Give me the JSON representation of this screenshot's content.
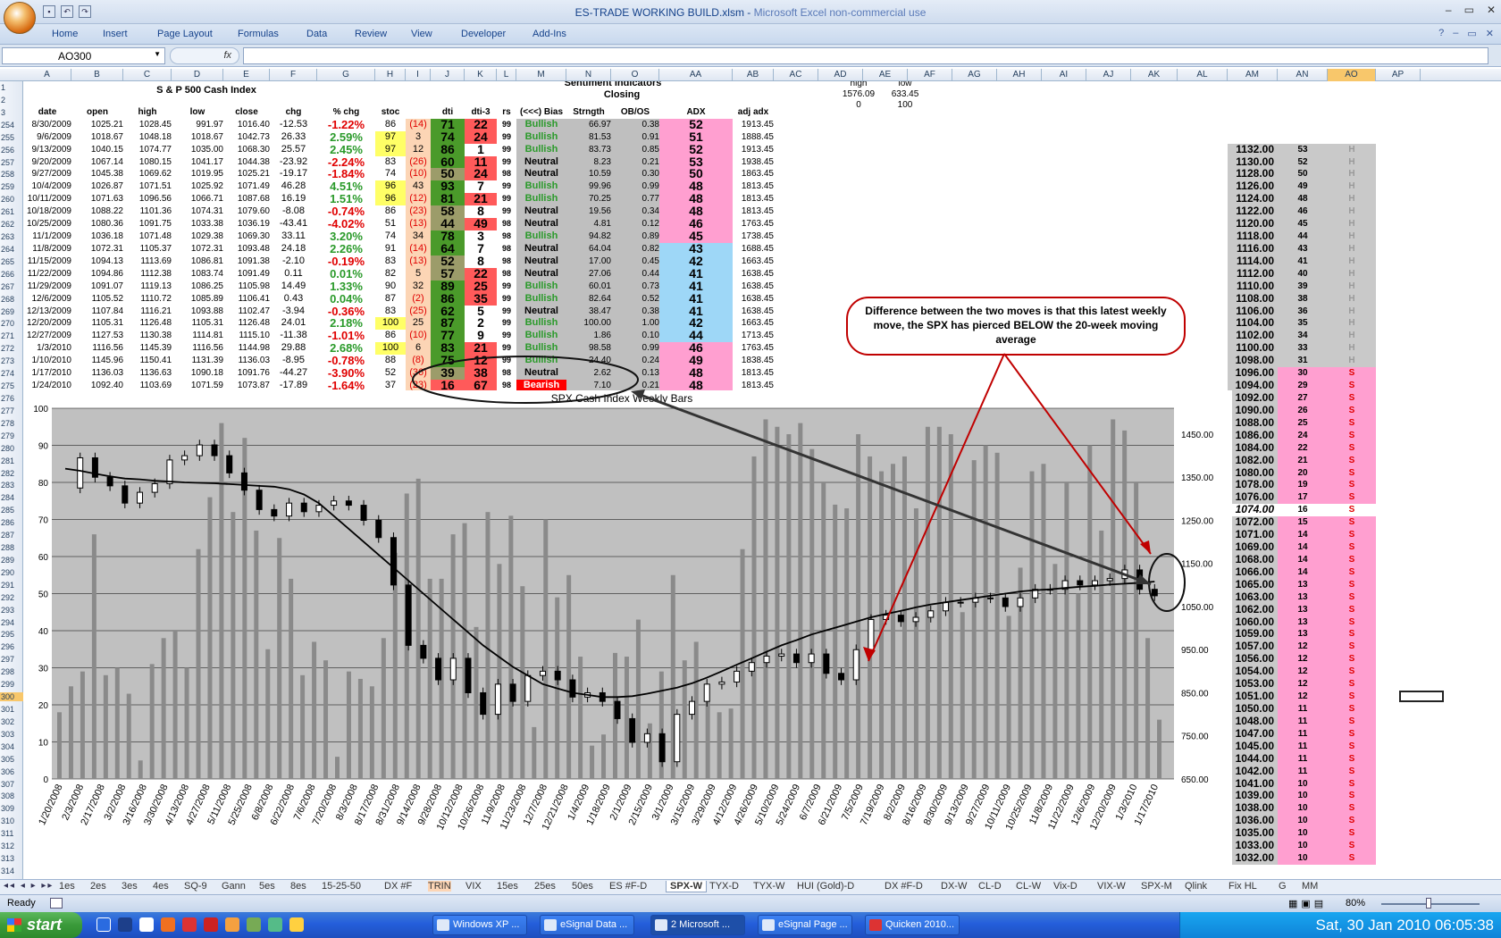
{
  "window": {
    "title": "ES-TRADE WORKING BUILD.xlsm",
    "subtitle": "Microsoft Excel non-commercial use",
    "minimize": "–",
    "restore": "▭",
    "close": "✕"
  },
  "ribbon": {
    "tabs": [
      "Home",
      "Insert",
      "Page Layout",
      "Formulas",
      "Data",
      "Review",
      "View",
      "Developer",
      "Add-Ins"
    ]
  },
  "formula_bar": {
    "name_box": "AO300",
    "fx": "fx",
    "value": ""
  },
  "columns": [
    "A",
    "B",
    "C",
    "D",
    "E",
    "F",
    "G",
    "H",
    "I",
    "J",
    "K",
    "L",
    "M",
    "N",
    "O",
    "AA",
    "AB",
    "AC",
    "AD",
    "AE",
    "AF",
    "AG",
    "AH",
    "AI",
    "AJ",
    "AK",
    "AL",
    "AM",
    "AN",
    "AO",
    "AP"
  ],
  "selected_column": "AO",
  "rows_visible": [
    "1",
    "2",
    "3",
    "254",
    "255",
    "256",
    "257",
    "258",
    "259",
    "260",
    "261",
    "262",
    "263",
    "264",
    "265",
    "266",
    "267",
    "268",
    "269",
    "270",
    "271",
    "272",
    "273",
    "274",
    "275",
    "276",
    "277",
    "278",
    "279",
    "280",
    "281",
    "282",
    "283",
    "284",
    "285",
    "286",
    "287",
    "288",
    "289",
    "290",
    "291",
    "292",
    "293",
    "294",
    "295",
    "296",
    "297",
    "298",
    "299",
    "300",
    "301",
    "302",
    "303",
    "304",
    "305",
    "306",
    "307",
    "308",
    "309",
    "310",
    "311",
    "312",
    "313",
    "314"
  ],
  "headers": {
    "sp500": "S & P 500 Cash Index",
    "sentiment": "Sentiment Indicators",
    "closing": "Closing",
    "cols": [
      "date",
      "open",
      "high",
      "low",
      "close",
      "chg",
      "% chg",
      "stoc",
      "",
      "dti",
      "dti-3",
      "rs",
      "(<<<) Bias",
      "Strngth",
      "OB/OS",
      "ADX",
      "adj adx"
    ],
    "hl": {
      "high_label": "high",
      "low_label": "low",
      "high_val": "1576.09",
      "low_val": "633.45",
      "high_sub": "0",
      "low_sub": "100"
    }
  },
  "data_rows": [
    [
      "8/30/2009",
      "1025.21",
      "1028.45",
      "991.97",
      "1016.40",
      "-12.53",
      "-1.22%",
      "86",
      "(14)",
      "71",
      "22",
      "99",
      "Bullish",
      "66.97",
      "0.38",
      "52",
      "1913.45"
    ],
    [
      "9/6/2009",
      "1018.67",
      "1048.18",
      "1018.67",
      "1042.73",
      "26.33",
      "2.59%",
      "97",
      "3",
      "74",
      "24",
      "99",
      "Bullish",
      "81.53",
      "0.91",
      "51",
      "1888.45"
    ],
    [
      "9/13/2009",
      "1040.15",
      "1074.77",
      "1035.00",
      "1068.30",
      "25.57",
      "2.45%",
      "97",
      "12",
      "86",
      "1",
      "99",
      "Bullish",
      "83.73",
      "0.85",
      "52",
      "1913.45"
    ],
    [
      "9/20/2009",
      "1067.14",
      "1080.15",
      "1041.17",
      "1044.38",
      "-23.92",
      "-2.24%",
      "83",
      "(26)",
      "60",
      "11",
      "99",
      "Neutral",
      "8.23",
      "0.21",
      "53",
      "1938.45"
    ],
    [
      "9/27/2009",
      "1045.38",
      "1069.62",
      "1019.95",
      "1025.21",
      "-19.17",
      "-1.84%",
      "74",
      "(10)",
      "50",
      "24",
      "98",
      "Neutral",
      "10.59",
      "0.30",
      "50",
      "1863.45"
    ],
    [
      "10/4/2009",
      "1026.87",
      "1071.51",
      "1025.92",
      "1071.49",
      "46.28",
      "4.51%",
      "96",
      "43",
      "93",
      "7",
      "99",
      "Bullish",
      "99.96",
      "0.99",
      "48",
      "1813.45"
    ],
    [
      "10/11/2009",
      "1071.63",
      "1096.56",
      "1066.71",
      "1087.68",
      "16.19",
      "1.51%",
      "96",
      "(12)",
      "81",
      "21",
      "99",
      "Bullish",
      "70.25",
      "0.77",
      "48",
      "1813.45"
    ],
    [
      "10/18/2009",
      "1088.22",
      "1101.36",
      "1074.31",
      "1079.60",
      "-8.08",
      "-0.74%",
      "86",
      "(23)",
      "58",
      "8",
      "99",
      "Neutral",
      "19.56",
      "0.34",
      "48",
      "1813.45"
    ],
    [
      "10/25/2009",
      "1080.36",
      "1091.75",
      "1033.38",
      "1036.19",
      "-43.41",
      "-4.02%",
      "51",
      "(13)",
      "44",
      "49",
      "98",
      "Neutral",
      "4.81",
      "0.12",
      "46",
      "1763.45"
    ],
    [
      "11/1/2009",
      "1036.18",
      "1071.48",
      "1029.38",
      "1069.30",
      "33.11",
      "3.20%",
      "74",
      "34",
      "78",
      "3",
      "98",
      "Bullish",
      "94.82",
      "0.89",
      "45",
      "1738.45"
    ],
    [
      "11/8/2009",
      "1072.31",
      "1105.37",
      "1072.31",
      "1093.48",
      "24.18",
      "2.26%",
      "91",
      "(14)",
      "64",
      "7",
      "98",
      "Neutral",
      "64.04",
      "0.82",
      "43",
      "1688.45"
    ],
    [
      "11/15/2009",
      "1094.13",
      "1113.69",
      "1086.81",
      "1091.38",
      "-2.10",
      "-0.19%",
      "83",
      "(13)",
      "52",
      "8",
      "98",
      "Neutral",
      "17.00",
      "0.45",
      "42",
      "1663.45"
    ],
    [
      "11/22/2009",
      "1094.86",
      "1112.38",
      "1083.74",
      "1091.49",
      "0.11",
      "0.01%",
      "82",
      "5",
      "57",
      "22",
      "98",
      "Neutral",
      "27.06",
      "0.44",
      "41",
      "1638.45"
    ],
    [
      "11/29/2009",
      "1091.07",
      "1119.13",
      "1086.25",
      "1105.98",
      "14.49",
      "1.33%",
      "90",
      "32",
      "89",
      "25",
      "99",
      "Bullish",
      "60.01",
      "0.73",
      "41",
      "1638.45"
    ],
    [
      "12/6/2009",
      "1105.52",
      "1110.72",
      "1085.89",
      "1106.41",
      "0.43",
      "0.04%",
      "87",
      "(2)",
      "86",
      "35",
      "99",
      "Bullish",
      "82.64",
      "0.52",
      "41",
      "1638.45"
    ],
    [
      "12/13/2009",
      "1107.84",
      "1116.21",
      "1093.88",
      "1102.47",
      "-3.94",
      "-0.36%",
      "83",
      "(25)",
      "62",
      "5",
      "99",
      "Neutral",
      "38.47",
      "0.38",
      "41",
      "1638.45"
    ],
    [
      "12/20/2009",
      "1105.31",
      "1126.48",
      "1105.31",
      "1126.48",
      "24.01",
      "2.18%",
      "100",
      "25",
      "87",
      "2",
      "99",
      "Bullish",
      "100.00",
      "1.00",
      "42",
      "1663.45"
    ],
    [
      "12/27/2009",
      "1127.53",
      "1130.38",
      "1114.81",
      "1115.10",
      "-11.38",
      "-1.01%",
      "86",
      "(10)",
      "77",
      "9",
      "99",
      "Bullish",
      "1.86",
      "0.10",
      "44",
      "1713.45"
    ],
    [
      "1/3/2010",
      "1116.56",
      "1145.39",
      "1116.56",
      "1144.98",
      "29.88",
      "2.68%",
      "100",
      "6",
      "83",
      "21",
      "99",
      "Bullish",
      "98.58",
      "0.99",
      "46",
      "1763.45"
    ],
    [
      "1/10/2010",
      "1145.96",
      "1150.41",
      "1131.39",
      "1136.03",
      "-8.95",
      "-0.78%",
      "88",
      "(8)",
      "75",
      "12",
      "99",
      "Bullish",
      "24.40",
      "0.24",
      "49",
      "1838.45"
    ],
    [
      "1/17/2010",
      "1136.03",
      "1136.63",
      "1090.18",
      "1091.76",
      "-44.27",
      "-3.90%",
      "52",
      "(36)",
      "39",
      "38",
      "98",
      "Neutral",
      "2.62",
      "0.13",
      "48",
      "1813.45"
    ],
    [
      "1/24/2010",
      "1092.40",
      "1103.69",
      "1071.59",
      "1073.87",
      "-17.89",
      "-1.64%",
      "37",
      "(23)",
      "16",
      "67",
      "98",
      "Bearish",
      "7.10",
      "0.21",
      "48",
      "1813.45"
    ]
  ],
  "right_table": [
    [
      "1132.00",
      "53",
      "H"
    ],
    [
      "1130.00",
      "52",
      "H"
    ],
    [
      "1128.00",
      "50",
      "H"
    ],
    [
      "1126.00",
      "49",
      "H"
    ],
    [
      "1124.00",
      "48",
      "H"
    ],
    [
      "1122.00",
      "46",
      "H"
    ],
    [
      "1120.00",
      "45",
      "H"
    ],
    [
      "1118.00",
      "44",
      "H"
    ],
    [
      "1116.00",
      "43",
      "H"
    ],
    [
      "1114.00",
      "41",
      "H"
    ],
    [
      "1112.00",
      "40",
      "H"
    ],
    [
      "1110.00",
      "39",
      "H"
    ],
    [
      "1108.00",
      "38",
      "H"
    ],
    [
      "1106.00",
      "36",
      "H"
    ],
    [
      "1104.00",
      "35",
      "H"
    ],
    [
      "1102.00",
      "34",
      "H"
    ],
    [
      "1100.00",
      "33",
      "H"
    ],
    [
      "1098.00",
      "31",
      "H"
    ],
    [
      "1096.00",
      "30",
      "S"
    ],
    [
      "1094.00",
      "29",
      "S"
    ],
    [
      "1092.00",
      "27",
      "S"
    ],
    [
      "1090.00",
      "26",
      "S"
    ],
    [
      "1088.00",
      "25",
      "S"
    ],
    [
      "1086.00",
      "24",
      "S"
    ],
    [
      "1084.00",
      "22",
      "S"
    ],
    [
      "1082.00",
      "21",
      "S"
    ],
    [
      "1080.00",
      "20",
      "S"
    ],
    [
      "1078.00",
      "19",
      "S"
    ],
    [
      "1076.00",
      "17",
      "S"
    ],
    [
      "1074.00",
      "16",
      "S"
    ],
    [
      "1072.00",
      "15",
      "S"
    ],
    [
      "1071.00",
      "14",
      "S"
    ],
    [
      "1069.00",
      "14",
      "S"
    ],
    [
      "1068.00",
      "14",
      "S"
    ],
    [
      "1066.00",
      "14",
      "S"
    ],
    [
      "1065.00",
      "13",
      "S"
    ],
    [
      "1063.00",
      "13",
      "S"
    ],
    [
      "1062.00",
      "13",
      "S"
    ],
    [
      "1060.00",
      "13",
      "S"
    ],
    [
      "1059.00",
      "13",
      "S"
    ],
    [
      "1057.00",
      "12",
      "S"
    ],
    [
      "1056.00",
      "12",
      "S"
    ],
    [
      "1054.00",
      "12",
      "S"
    ],
    [
      "1053.00",
      "12",
      "S"
    ],
    [
      "1051.00",
      "12",
      "S"
    ],
    [
      "1050.00",
      "11",
      "S"
    ],
    [
      "1048.00",
      "11",
      "S"
    ],
    [
      "1047.00",
      "11",
      "S"
    ],
    [
      "1045.00",
      "11",
      "S"
    ],
    [
      "1044.00",
      "11",
      "S"
    ],
    [
      "1042.00",
      "11",
      "S"
    ],
    [
      "1041.00",
      "10",
      "S"
    ],
    [
      "1039.00",
      "10",
      "S"
    ],
    [
      "1038.00",
      "10",
      "S"
    ],
    [
      "1036.00",
      "10",
      "S"
    ],
    [
      "1035.00",
      "10",
      "S"
    ],
    [
      "1033.00",
      "10",
      "S"
    ],
    [
      "1032.00",
      "10",
      "S"
    ]
  ],
  "callout": "Difference between the two moves is that this latest weekly move, the SPX has pierced BELOW the 20-week moving average",
  "chart_data": {
    "type": "candlestick",
    "title": "SPX Cash Index Weekly Bars",
    "left_axis": {
      "ticks": [
        "100",
        "90",
        "80",
        "70",
        "60",
        "50",
        "40",
        "30",
        "20",
        "10",
        "0"
      ],
      "range": [
        0,
        100
      ]
    },
    "right_axis": {
      "ticks": [
        "1450.00",
        "1350.00",
        "1250.00",
        "1150.00",
        "1050.00",
        "950.00",
        "850.00",
        "750.00",
        "650.00"
      ],
      "range": [
        650,
        1510
      ]
    },
    "x_labels": [
      "1/20/2008",
      "2/3/2008",
      "2/17/2008",
      "3/2/2008",
      "3/16/2008",
      "3/30/2008",
      "4/13/2008",
      "4/27/2008",
      "5/11/2008",
      "5/25/2008",
      "6/8/2008",
      "6/22/2008",
      "7/6/2008",
      "7/20/2008",
      "8/3/2008",
      "8/17/2008",
      "8/31/2008",
      "9/14/2008",
      "9/28/2008",
      "10/12/2008",
      "10/26/2008",
      "11/9/2008",
      "11/23/2008",
      "12/7/2008",
      "12/21/2008",
      "1/4/2009",
      "1/18/2009",
      "2/1/2009",
      "2/15/2009",
      "3/1/2009",
      "3/15/2009",
      "3/29/2009",
      "4/12/2009",
      "4/26/2009",
      "5/10/2009",
      "5/24/2009",
      "6/7/2009",
      "6/21/2009",
      "7/5/2009",
      "7/19/2009",
      "8/2/2009",
      "8/16/2009",
      "8/30/2009",
      "9/13/2009",
      "9/27/2009",
      "10/11/2009",
      "10/25/2009",
      "11/8/2009",
      "11/22/2009",
      "12/6/2009",
      "12/20/2009",
      "1/3/2010",
      "1/17/2010"
    ],
    "closes": [
      1325,
      1395,
      1350,
      1330,
      1290,
      1315,
      1335,
      1390,
      1400,
      1425,
      1400,
      1360,
      1320,
      1275,
      1260,
      1290,
      1270,
      1285,
      1295,
      1285,
      1250,
      1210,
      1100,
      960,
      930,
      880,
      930,
      850,
      800,
      870,
      830,
      890,
      900,
      880,
      840,
      850,
      830,
      790,
      735,
      755,
      690,
      800,
      830,
      870,
      875,
      900,
      920,
      935,
      940,
      920,
      940,
      895,
      880,
      950,
      1020,
      1030,
      1015,
      1025,
      1040,
      1060,
      1060,
      1070,
      1070,
      1050,
      1070,
      1090,
      1090,
      1110,
      1100,
      1110,
      1115,
      1135,
      1090,
      1075
    ],
    "moving_average_label": "20-week moving average",
    "ma": [
      1370,
      1365,
      1358,
      1352,
      1347,
      1345,
      1342,
      1340,
      1338,
      1337,
      1336,
      1334,
      1332,
      1330,
      1328,
      1322,
      1310,
      1290,
      1260,
      1230,
      1200,
      1170,
      1140,
      1110,
      1080,
      1050,
      1020,
      990,
      960,
      935,
      910,
      890,
      870,
      860,
      850,
      845,
      840,
      840,
      842,
      848,
      855,
      862,
      872,
      885,
      900,
      915,
      930,
      945,
      960,
      972,
      985,
      995,
      1005,
      1015,
      1025,
      1033,
      1040,
      1048,
      1055,
      1060,
      1065,
      1070,
      1075,
      1080,
      1085,
      1088,
      1090,
      1093,
      1096,
      1098,
      1101,
      1103,
      1105,
      1108
    ],
    "stoc_bars": [
      18,
      25,
      29,
      66,
      28,
      30,
      23,
      5,
      31,
      38,
      40,
      30,
      62,
      76,
      96,
      72,
      92,
      67,
      35,
      65,
      54,
      28,
      37,
      32,
      6,
      29,
      27,
      25,
      38,
      61,
      77,
      81,
      54,
      54,
      66,
      69,
      41,
      72,
      58,
      71,
      52,
      14,
      70,
      49,
      55,
      33,
      9,
      12,
      34,
      33,
      43,
      15,
      29,
      55,
      32,
      37,
      25,
      18,
      19,
      62,
      87,
      97,
      95,
      93,
      96,
      89,
      80,
      74,
      73,
      93,
      87,
      83,
      85,
      87,
      73,
      95,
      95,
      93,
      45,
      86,
      90,
      88,
      44,
      57,
      83,
      85,
      58,
      80,
      50,
      90,
      67,
      97,
      94,
      80,
      38,
      16
    ]
  },
  "sheet_tabs": [
    "1es",
    "2es",
    "3es",
    "4es",
    "SQ-9",
    "Gann",
    "5es",
    "8es",
    "15-25-50",
    "DX #F",
    "TRIN",
    "VIX",
    "15es",
    "25es",
    "50es",
    "ES #F-D",
    "SPX-W",
    "TYX-D",
    "TYX-W",
    "HUI (Gold)-D",
    "DX #F-D",
    "DX-W",
    "CL-D",
    "CL-W",
    "Vix-D",
    "VIX-W",
    "SPX-M",
    "Qlink",
    "Fix HL",
    "G",
    "MM"
  ],
  "active_sheet": "SPX-W",
  "status": {
    "ready": "Ready",
    "zoom": "80%"
  },
  "taskbar": {
    "start": "start",
    "tasks": [
      "Windows XP ...",
      "eSignal Data ...",
      "2 Microsoft ...",
      "eSignal Page ...",
      "Quicken 2010..."
    ],
    "clock": "Sat, 30 Jan 2010   06:05:38"
  },
  "colors": {
    "green_cell": "#4a9a2a",
    "red_cell": "#ff5a5a",
    "yellow_cell": "#ffff66",
    "orange_cell": "#fcd5b5",
    "pink_cell": "#ff9fd0",
    "blue_cell": "#9ed7f7",
    "gray_cell": "#bfbfbf",
    "chart_bg": "#c0c0c0"
  }
}
